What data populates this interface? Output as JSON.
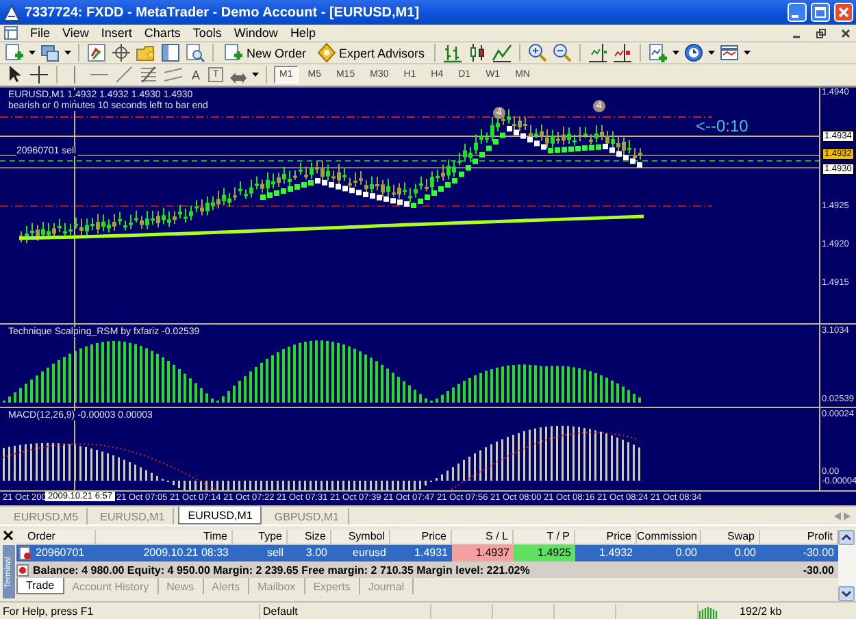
{
  "window": {
    "title": "7337724: FXDD - MetaTrader - Demo Account - [EURUSD,M1]"
  },
  "menu": [
    "File",
    "View",
    "Insert",
    "Charts",
    "Tools",
    "Window",
    "Help"
  ],
  "toolbar": [
    {
      "kind": "new-chart",
      "dropdown": true
    },
    {
      "kind": "profiles",
      "dropdown": true
    },
    {
      "kind": "separator"
    },
    {
      "kind": "market-watch"
    },
    {
      "kind": "data-window"
    },
    {
      "kind": "folder"
    },
    {
      "kind": "navigator"
    },
    {
      "kind": "tester"
    },
    {
      "kind": "separator"
    },
    {
      "kind": "new-order",
      "label": "New Order"
    },
    {
      "kind": "expert",
      "label": "Expert Advisors"
    },
    {
      "kind": "separator"
    },
    {
      "kind": "bar-chart"
    },
    {
      "kind": "candles"
    },
    {
      "kind": "line-chart"
    },
    {
      "kind": "separator"
    },
    {
      "kind": "zoom-in"
    },
    {
      "kind": "zoom-out"
    },
    {
      "kind": "separator"
    },
    {
      "kind": "autoscroll"
    },
    {
      "kind": "shift"
    },
    {
      "kind": "separator"
    },
    {
      "kind": "indicators",
      "dropdown": true
    },
    {
      "kind": "periods",
      "dropdown": true
    },
    {
      "kind": "templates",
      "dropdown": true
    }
  ],
  "drawing_tools": [
    {
      "kind": "cursor"
    },
    {
      "kind": "crosshair"
    },
    {
      "kind": "separator"
    },
    {
      "kind": "vline"
    },
    {
      "kind": "hline"
    },
    {
      "kind": "trendline"
    },
    {
      "kind": "fibonacci"
    },
    {
      "kind": "channel"
    },
    {
      "kind": "text",
      "label": "A"
    },
    {
      "kind": "label",
      "label": "T"
    },
    {
      "kind": "arrows",
      "dropdown": true
    }
  ],
  "periods": [
    {
      "label": "M1",
      "selected": true
    },
    {
      "label": "M5",
      "selected": false
    },
    {
      "label": "M15",
      "selected": false
    },
    {
      "label": "M30",
      "selected": false
    },
    {
      "label": "H1",
      "selected": false
    },
    {
      "label": "H4",
      "selected": false
    },
    {
      "label": "D1",
      "selected": false
    },
    {
      "label": "W1",
      "selected": false
    },
    {
      "label": "MN",
      "selected": false
    }
  ],
  "chart": {
    "header": "EURUSD,M1  1.4932 1.4932 1.4930 1.4930",
    "note": "bearish or 0 minutes 10 seconds left to bar end",
    "order_label": "20960701 sell",
    "countdown": "<--0:10",
    "markers": [
      "4",
      "4"
    ],
    "price_axis": [
      "1.4940",
      "1.4925",
      "1.4920",
      "1.4915"
    ],
    "price_tags": [
      {
        "label": "1.4934",
        "kind": "line"
      },
      {
        "label": "1.4932",
        "kind": "bid"
      },
      {
        "label": "1.4930",
        "kind": "line"
      }
    ],
    "indicator": {
      "title": "Technique Scalping_RSM by fxfariz -0.02539",
      "axis": [
        "3.1034",
        "0.02539"
      ]
    },
    "macd": {
      "title": "MACD(12,26,9) -0.00003 0.00003",
      "axis": [
        "0.00024",
        "0.00",
        "-0.00004"
      ]
    },
    "time_axis": [
      "21 Oct 200",
      "21 Oct 07:05",
      "21 Oct 07:14",
      "21 Oct 07:22",
      "21 Oct 07:31",
      "21 Oct 07:39",
      "21 Oct 07:47",
      "21 Oct 07:56",
      "21 Oct 08:00",
      "21 Oct 08:16",
      "21 Oct 08:24",
      "21 Oct 08:34"
    ],
    "cursor_time": "2009.10.21 6:57"
  },
  "chart_tabs": [
    {
      "label": "EURUSD,M5",
      "selected": false
    },
    {
      "label": "EURUSD,M1",
      "selected": false
    },
    {
      "label": "EURUSD,M1",
      "selected": true
    },
    {
      "label": "GBPUSD,M1",
      "selected": false
    }
  ],
  "terminal": {
    "title": "Terminal",
    "columns": [
      {
        "label": "Order",
        "kind": "plain"
      },
      {
        "label": "Time",
        "kind": "plain"
      },
      {
        "label": "Type",
        "kind": "plain"
      },
      {
        "label": "Size",
        "kind": "plain"
      },
      {
        "label": "Symbol",
        "kind": "plain"
      },
      {
        "label": "Price",
        "kind": "plain"
      },
      {
        "label": "S / L",
        "kind": "stop"
      },
      {
        "label": "T / P",
        "kind": "target"
      },
      {
        "label": "Price",
        "kind": "plain"
      },
      {
        "label": "Commission",
        "kind": "plain"
      },
      {
        "label": "Swap",
        "kind": "plain"
      },
      {
        "label": "Profit",
        "kind": "plain"
      }
    ],
    "rows": [
      {
        "selected": true,
        "cells": [
          "20960701",
          "2009.10.21 08:33",
          "sell",
          "3.00",
          "eurusd",
          "1.4931",
          "1.4937",
          "1.4925",
          "1.4932",
          "0.00",
          "0.00",
          "-30.00"
        ]
      }
    ],
    "summary": "Balance: 4 980.00  Equity: 4 950.00  Margin: 2 239.65  Free margin: 2 710.35  Margin level: 221.02%",
    "summary_profit": "-30.00",
    "tabs": [
      {
        "label": "Trade",
        "selected": true
      },
      {
        "label": "Account History",
        "selected": false
      },
      {
        "label": "News",
        "selected": false
      },
      {
        "label": "Alerts",
        "selected": false
      },
      {
        "label": "Mailbox",
        "selected": false
      },
      {
        "label": "Experts",
        "selected": false
      },
      {
        "label": "Journal",
        "selected": false
      }
    ]
  },
  "status_bar": {
    "help": "For Help, press F1",
    "profile": "Default",
    "traffic": "192/2 kb"
  }
}
